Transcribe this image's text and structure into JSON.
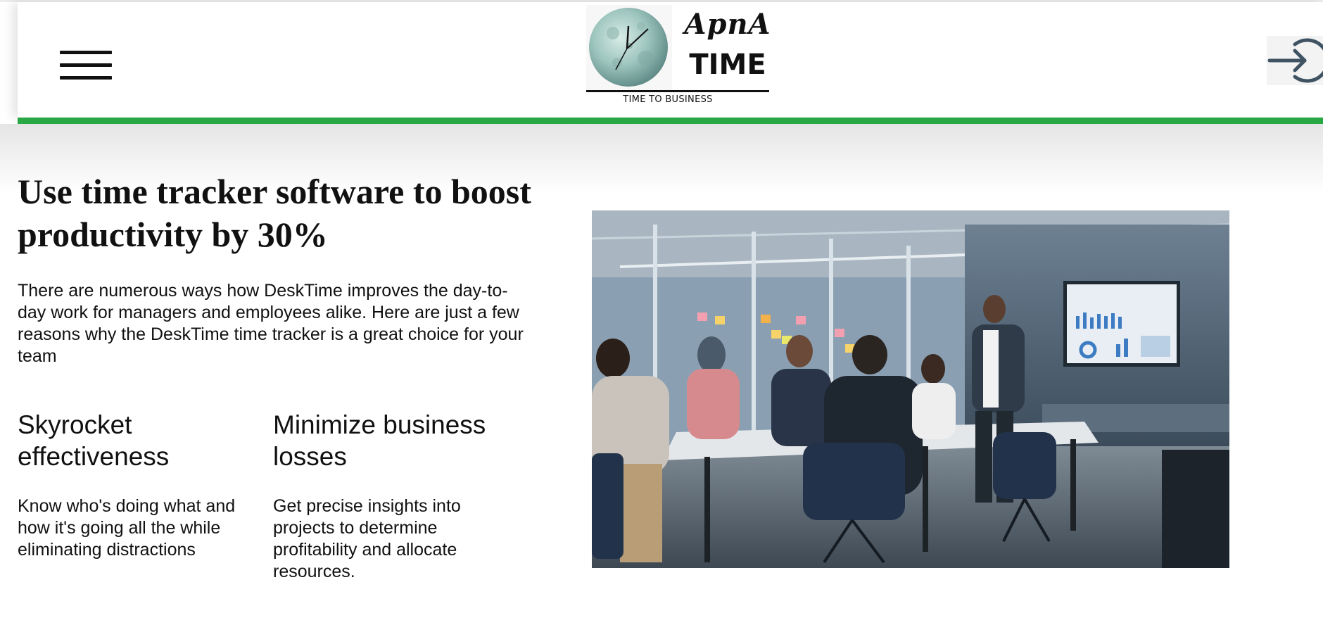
{
  "header": {
    "menu_icon": "hamburger-menu-icon",
    "logo": {
      "script_text": "ApnA",
      "word_text": "TIME",
      "tagline": "TIME TO BUSINESS"
    },
    "login_icon": "sign-in-arrow-icon"
  },
  "colors": {
    "accent_bar": "#28a745",
    "text": "#111111",
    "background": "#ffffff"
  },
  "hero": {
    "headline": "Use time tracker software to boost productivity by 30%",
    "intro": "There are numerous ways how DeskTime improves the day-to-day work for managers and employees alike. Here are just a few reasons why the DeskTime time tracker is a great choice for your team",
    "features": [
      {
        "title": "Skyrocket effectiveness",
        "text": "Know who's doing what and how it's going all the while eliminating distractions"
      },
      {
        "title": "Minimize business losses",
        "text": "Get precise insights into projects to determine profitability and allocate resources."
      }
    ],
    "image": "office-meeting-photo"
  }
}
